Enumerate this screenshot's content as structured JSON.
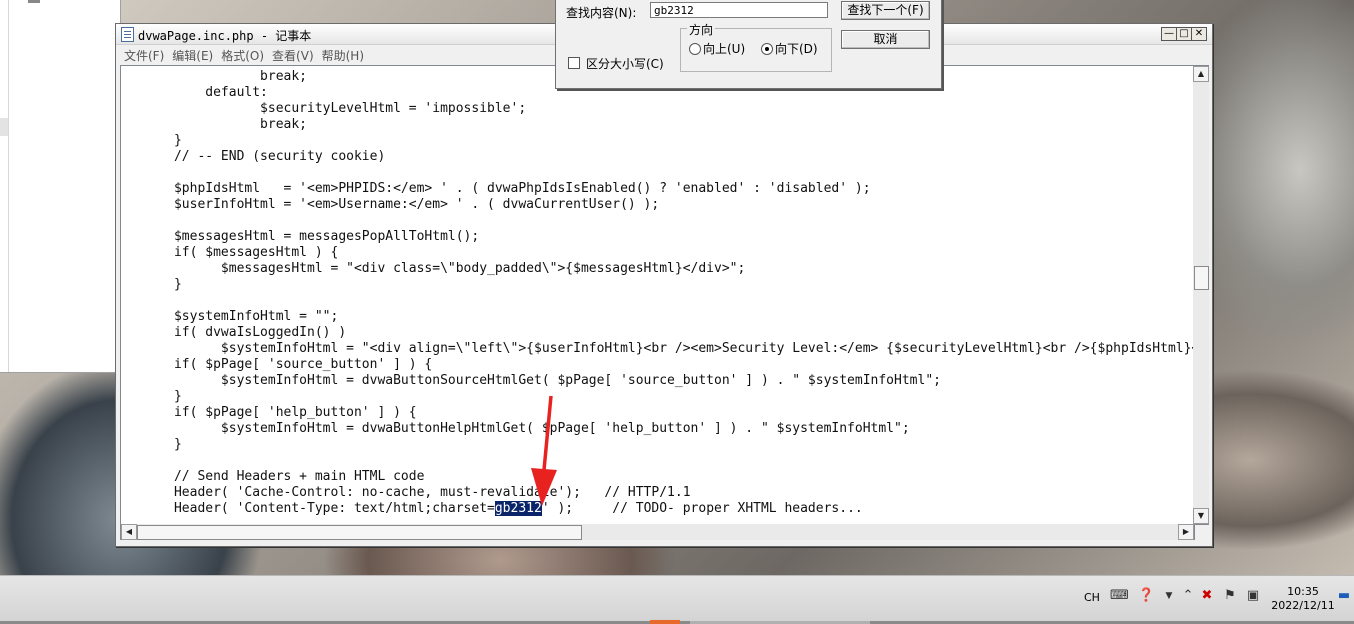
{
  "notepad": {
    "title": "dvwaPage.inc.php - 记事本",
    "menu": [
      "文件(F)",
      "编辑(E)",
      "格式(O)",
      "查看(V)",
      "帮助(H)"
    ],
    "code_before_highlight": "                 break;\n          default:\n                 $securityLevelHtml = 'impossible';\n                 break;\n      }\n      // -- END (security cookie)\n\n      $phpIdsHtml   = '<em>PHPIDS:</em> ' . ( dvwaPhpIdsIsEnabled() ? 'enabled' : 'disabled' );\n      $userInfoHtml = '<em>Username:</em> ' . ( dvwaCurrentUser() );\n\n      $messagesHtml = messagesPopAllToHtml();\n      if( $messagesHtml ) {\n            $messagesHtml = \"<div class=\\\"body_padded\\\">{$messagesHtml}</div>\";\n      }\n\n      $systemInfoHtml = \"\";\n      if( dvwaIsLoggedIn() )\n            $systemInfoHtml = \"<div align=\\\"left\\\">{$userInfoHtml}<br /><em>Security Level:</em> {$securityLevelHtml}<br />{$phpIdsHtml}</div>\";\n      if( $pPage[ 'source_button' ] ) {\n            $systemInfoHtml = dvwaButtonSourceHtmlGet( $pPage[ 'source_button' ] ) . \" $systemInfoHtml\";\n      }\n      if( $pPage[ 'help_button' ] ) {\n            $systemInfoHtml = dvwaButtonHelpHtmlGet( $pPage[ 'help_button' ] ) . \" $systemInfoHtml\";\n      }\n\n      // Send Headers + main HTML code\n      Header( 'Cache-Control: no-cache, must-revalidate');   // HTTP/1.1\n      Header( 'Content-Type: text/html;charset=",
    "code_highlight": "gb2312",
    "code_after_highlight": "' );     // TODO- proper XHTML headers..."
  },
  "find_dialog": {
    "find_label": "查找内容(N):",
    "find_value": "gb2312",
    "find_next_button": "查找下一个(F)",
    "cancel_button": "取消",
    "direction_label": "方向",
    "up_label": "向上(U)",
    "down_label": "向下(D)",
    "direction_selected": "down",
    "match_case_label": "区分大小写(C)",
    "match_case_checked": false
  },
  "taskbar": {
    "input_language": "CH",
    "clock_time": "10:35",
    "clock_date": "2022/12/11"
  },
  "colors": {
    "selection_bg": "#0a246a",
    "annotation_arrow": "#e8231f"
  }
}
